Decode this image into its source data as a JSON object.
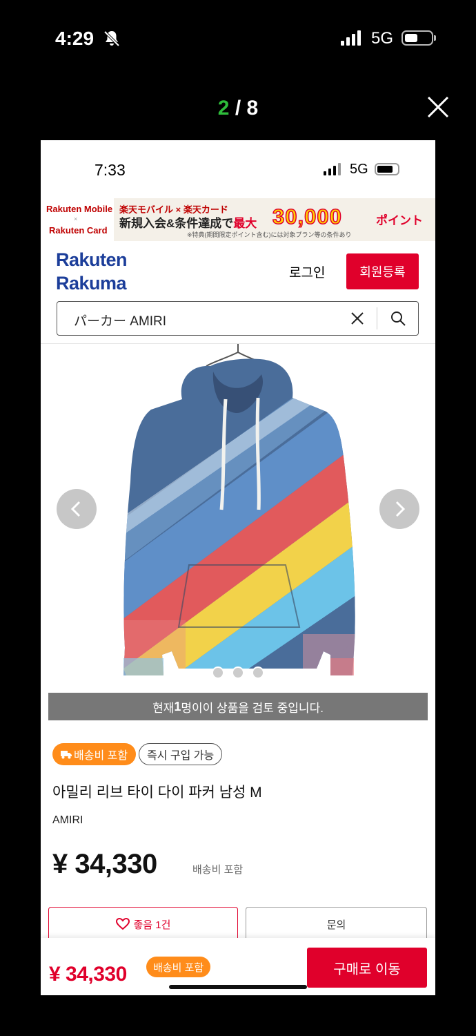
{
  "outer_status": {
    "time": "4:29",
    "network": "5G"
  },
  "viewer": {
    "current": "2",
    "separator": " / ",
    "total": "8"
  },
  "inner_status": {
    "time": "7:33",
    "network": "5G"
  },
  "banner": {
    "left_top": "Rakuten Mobile",
    "left_x": "×",
    "left_bottom": "Rakuten Card",
    "line1": "楽天モバイル × 楽天カード",
    "line2_a": "新規入会&条件達成で",
    "line2_b": "最大",
    "amount": "30,000",
    "points": "ポイント",
    "note": "※特典(期間限定ポイント含む)には対象プラン等の条件あり"
  },
  "header": {
    "logo_line1": "Rakuten",
    "logo_line2": "Rakuma",
    "login_label": "로그인",
    "signup_label": "회원등록"
  },
  "search": {
    "query": "パーカー AMIRI"
  },
  "gallery": {
    "slide_count": 3
  },
  "viewers_banner": {
    "prefix": "현재 ",
    "count": "1",
    "suffix": " 명이이 상품을 검토 중입니다."
  },
  "product": {
    "badge_shipping": "배송비 포함",
    "badge_buy": "즉시 구입 가능",
    "title": "아밀리 리브 타이 다이 파커 남성 M",
    "brand": "AMIRI",
    "price": "¥ 34,330",
    "price_note": "배송비 포함"
  },
  "actions": {
    "like_label": "좋음 1건",
    "ask_label": "문의"
  },
  "bottom_bar": {
    "price": "¥ 34,330",
    "badge": "배송비 포함",
    "buy_label": "구매로 이동"
  },
  "colors": {
    "accent_red": "#e0002b",
    "brand_blue": "#1c3e9a",
    "badge_orange": "#ff8c1a",
    "counter_green": "#2ebd3b"
  }
}
